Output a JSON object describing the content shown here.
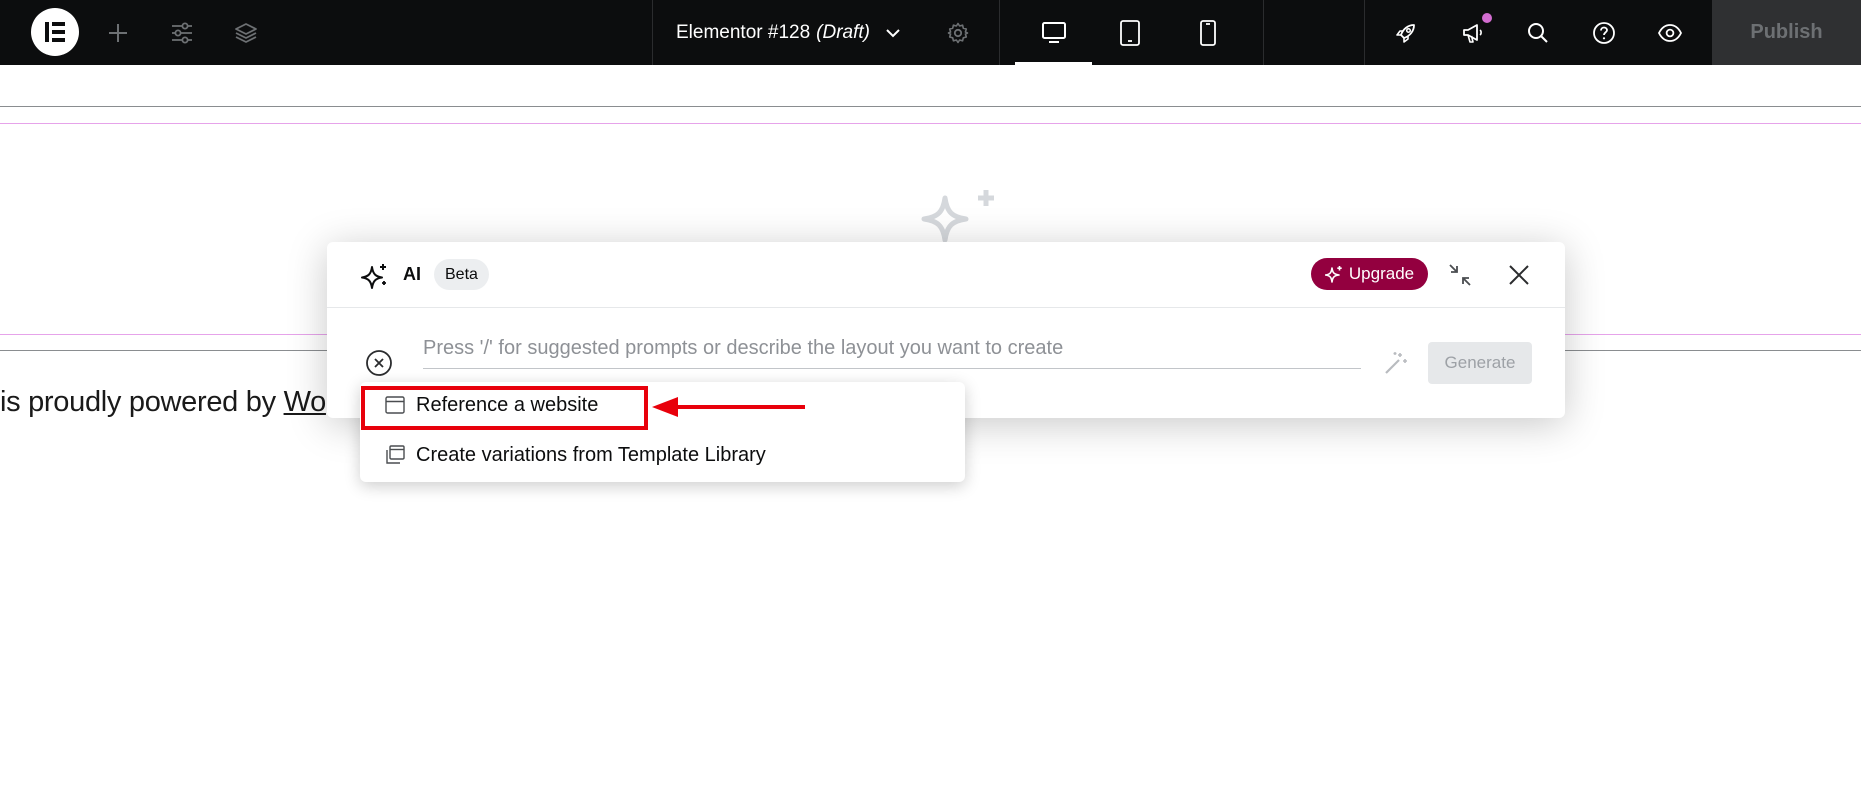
{
  "topbar": {
    "doc_name": "Elementor #128",
    "doc_status": "(Draft)",
    "publish_label": "Publish"
  },
  "canvas": {
    "footer_prefix": "is proudly powered by ",
    "footer_link": "Wo"
  },
  "ai_dialog": {
    "ai_label": "AI",
    "beta_label": "Beta",
    "upgrade_label": "Upgrade",
    "prompt_placeholder": "Press '/' for suggested prompts or describe the layout you want to create",
    "generate_label": "Generate"
  },
  "dropdown": {
    "items": [
      {
        "label": "Reference a website",
        "icon": "browser-window-icon"
      },
      {
        "label": "Create variations from Template Library",
        "icon": "template-stack-icon"
      }
    ]
  },
  "colors": {
    "topbar_bg": "#0c0d0e",
    "upgrade_bg": "#93003f",
    "annotation_red": "#e8000b",
    "notification_dot": "#d36dd0"
  }
}
